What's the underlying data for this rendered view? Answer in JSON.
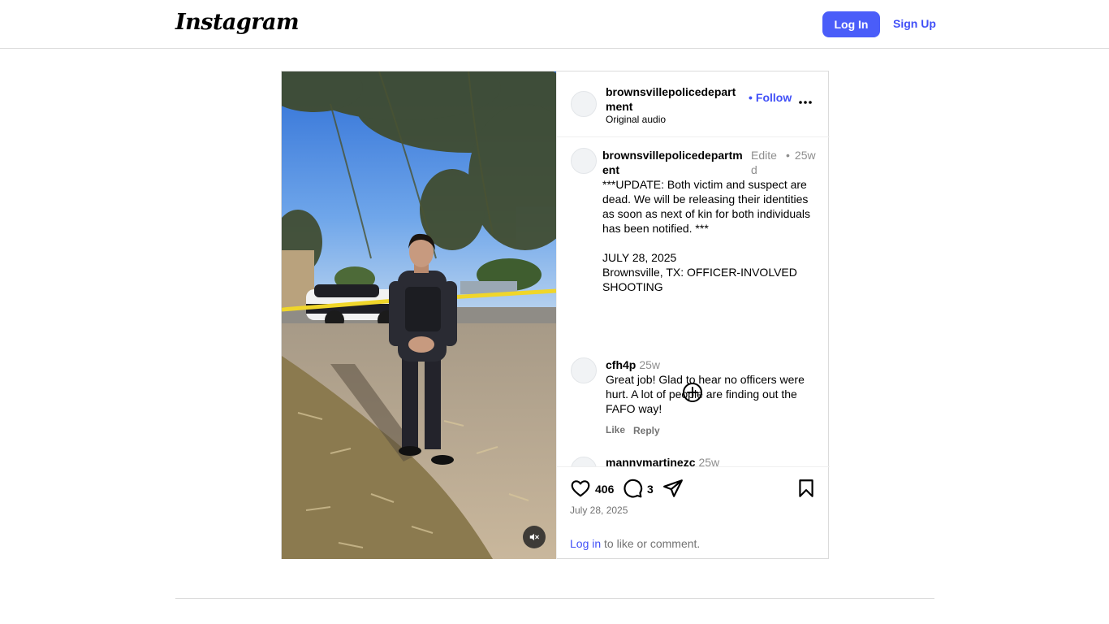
{
  "app": {
    "logo_text": "Instagram",
    "login_label": "Log In",
    "signup_label": "Sign Up",
    "accent_color": "#4a5df9"
  },
  "post": {
    "username": "brownsvillepolicedepartment",
    "audio": "Original audio",
    "follow_label": "Follow",
    "caption": {
      "username": "brownsvillepolicedepartment",
      "edited": "Edited",
      "time": "25w",
      "text": "***UPDATE: Both victim and suspect are dead. We will be releasing their identities as soon as next of kin for both individuals has been notified. ***\n\nJULY 28, 2025\nBrownsville, TX: OFFICER-INVOLVED SHOOTING"
    },
    "comments": [
      {
        "username": "cfh4p",
        "time": "25w",
        "text": "Great job! Glad to hear no officers were hurt. A lot of people are finding out the FAFO way!",
        "like_label": "Like",
        "reply_label": "Reply"
      },
      {
        "username": "mannymartinezc",
        "time": "25w"
      }
    ],
    "likes": "406",
    "comment_count": "3",
    "date": "July 28, 2025",
    "login_prompt_link": "Log in",
    "login_prompt_rest": " to like or comment."
  },
  "icons": {
    "more": "more-horizontal-icon",
    "load_more": "plus-circle-icon",
    "like": "heart-icon",
    "comment": "comment-icon",
    "share": "share-icon",
    "save": "bookmark-icon",
    "mute": "muted-speaker-icon"
  }
}
